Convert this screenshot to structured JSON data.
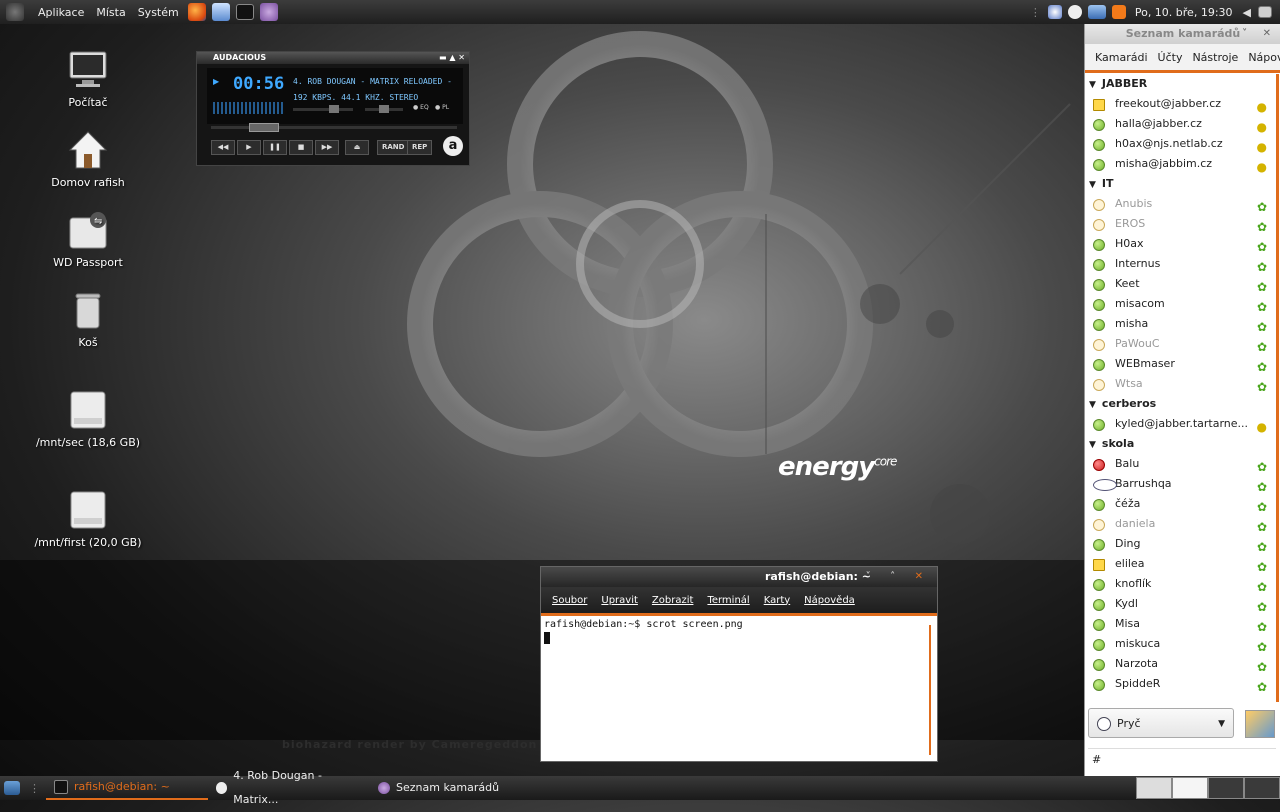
{
  "top_panel": {
    "menus": [
      "Aplikace",
      "Místa",
      "Systém"
    ],
    "clock": "Po, 10. bře, 19:30"
  },
  "desktop": {
    "icons": [
      {
        "label": "Počítač",
        "icon": "computer-icon"
      },
      {
        "label": "Domov rafish",
        "icon": "home-icon"
      },
      {
        "label": "WD Passport",
        "icon": "usb-drive-icon"
      },
      {
        "label": "Koš",
        "icon": "trash-icon"
      },
      {
        "label": "/mnt/sec (18,6 GB)",
        "icon": "drive-icon"
      },
      {
        "label": "/mnt/first (20,0 GB)",
        "icon": "drive-icon"
      }
    ],
    "wallpaper": {
      "brand": "energy",
      "brand_sup": "core",
      "credit": "biohazard render by Cameregeddon"
    }
  },
  "audacious": {
    "title": "AUDACIOUS",
    "time": "00:56",
    "track": "4. ROB DOUGAN - MATRIX RELOADED -",
    "info": "192 KBPS. 44.1 KHZ. STEREO",
    "eq_label": "EQ",
    "pl_label": "PL",
    "rand_label": "RAND",
    "rep_label": "REP",
    "logo": "a"
  },
  "buddy_list": {
    "title": "Seznam kamarádů",
    "menu": [
      "Kamarádi",
      "Účty",
      "Nástroje",
      "Nápov"
    ],
    "groups": [
      {
        "name": "JABBER",
        "buddies": [
          {
            "name": "freekout@jabber.cz",
            "status": "note",
            "right": "bulb"
          },
          {
            "name": "halla@jabber.cz",
            "status": "online",
            "right": "bulb"
          },
          {
            "name": "h0ax@njs.netlab.cz",
            "status": "online",
            "right": "bulb"
          },
          {
            "name": "misha@jabbim.cz",
            "status": "online",
            "right": "bulb"
          }
        ]
      },
      {
        "name": "IT",
        "buddies": [
          {
            "name": "Anubis",
            "status": "idle",
            "right": "flower",
            "dim": true
          },
          {
            "name": "EROS",
            "status": "idle",
            "right": "flower",
            "dim": true
          },
          {
            "name": "H0ax",
            "status": "online",
            "right": "flower"
          },
          {
            "name": "Internus",
            "status": "online",
            "right": "flower"
          },
          {
            "name": "Keet",
            "status": "online",
            "right": "flower"
          },
          {
            "name": "misacom",
            "status": "online",
            "right": "flower"
          },
          {
            "name": "misha",
            "status": "online",
            "right": "flower"
          },
          {
            "name": "PaWouC",
            "status": "idle",
            "right": "flower",
            "dim": true
          },
          {
            "name": "WEBmaser",
            "status": "online",
            "right": "flower"
          },
          {
            "name": "Wtsa",
            "status": "idle",
            "right": "flower",
            "dim": true
          }
        ]
      },
      {
        "name": "cerberos",
        "buddies": [
          {
            "name": "kyled@jabber.tartarne...",
            "status": "online",
            "right": "bulb"
          }
        ]
      },
      {
        "name": "skola",
        "buddies": [
          {
            "name": "Balu",
            "status": "busy",
            "right": "flower"
          },
          {
            "name": "Barrushqa",
            "status": "clock",
            "right": "flower"
          },
          {
            "name": "čéža",
            "status": "online",
            "right": "flower"
          },
          {
            "name": "daniela",
            "status": "idle",
            "right": "flower",
            "dim": true
          },
          {
            "name": "Ding",
            "status": "online",
            "right": "flower"
          },
          {
            "name": "elilea",
            "status": "note",
            "right": "flower"
          },
          {
            "name": "knoflík",
            "status": "online",
            "right": "flower"
          },
          {
            "name": "Kydl",
            "status": "online",
            "right": "flower"
          },
          {
            "name": "Misa",
            "status": "online",
            "right": "flower"
          },
          {
            "name": "miskuca",
            "status": "online",
            "right": "flower"
          },
          {
            "name": "Narzota",
            "status": "online",
            "right": "flower"
          },
          {
            "name": "SpiddeR",
            "status": "online",
            "right": "flower"
          }
        ]
      }
    ],
    "status_select": "Pryč",
    "message_field": "#"
  },
  "terminal": {
    "title": "rafish@debian: ~",
    "menu": [
      "Soubor",
      "Upravit",
      "Zobrazit",
      "Terminál",
      "Karty",
      "Nápověda"
    ],
    "lines": [
      "rafish@debian:~$ scrot screen.png"
    ]
  },
  "taskbar": {
    "tasks": [
      "rafish@debian: ~",
      "4. Rob Dougan - Matrix...",
      "Seznam kamarádů"
    ]
  },
  "colors": {
    "accent": "#e06c1b",
    "audacious_text": "#7fc8ff",
    "online": "#6fb12c"
  }
}
